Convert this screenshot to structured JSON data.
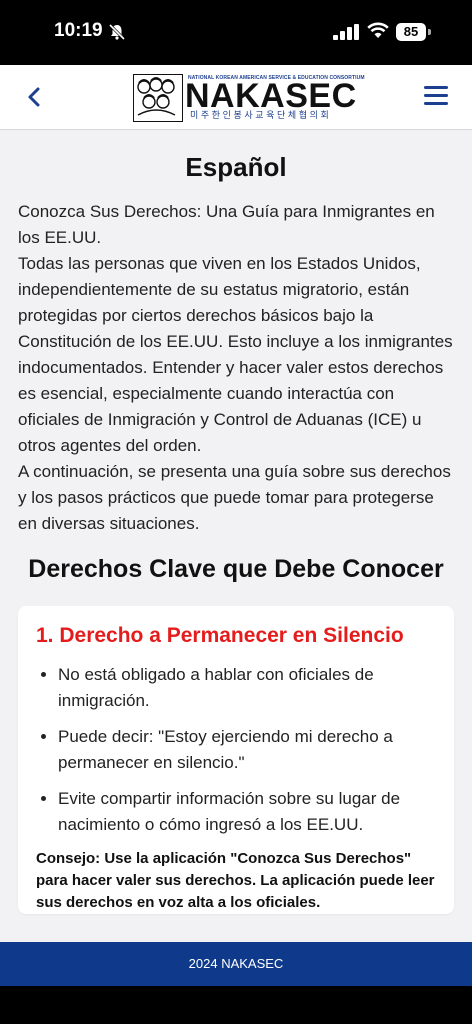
{
  "status_bar": {
    "time": "10:19",
    "battery": "85"
  },
  "header": {
    "logo_tagline": "NATIONAL KOREAN AMERICAN SERVICE & EDUCATION CONSORTIUM",
    "logo_name": "NAKASEC",
    "logo_korean": "미주한인봉사교육단체협의회"
  },
  "main": {
    "language_heading": "Español",
    "intro_paragraphs": [
      "Conozca Sus Derechos: Una Guía para Inmigrantes en los EE.UU.",
      "Todas las personas que viven en los Estados Unidos, independientemente de su estatus migratorio, están protegidas por ciertos derechos básicos bajo la Constitución de los EE.UU. Esto incluye a los inmigrantes indocumentados. Entender y hacer valer estos derechos es esencial, especialmente cuando interactúa con oficiales de Inmigración y Control de Aduanas (ICE) u otros agentes del orden.",
      "A continuación, se presenta una guía sobre sus derechos y los pasos prácticos que puede tomar para protegerse en diversas situaciones."
    ],
    "section_title": "Derechos Clave que Debe Conocer",
    "card": {
      "title": "1. Derecho a Permanecer en Silencio",
      "bullets": [
        "No está obligado a hablar con oficiales de inmigración.",
        "Puede decir: \"Estoy ejerciendo mi derecho a permanecer en silencio.\"",
        "Evite compartir información sobre su lugar de nacimiento o cómo ingresó a los EE.UU."
      ],
      "tip": "Consejo: Use la aplicación \"Conozca Sus Derechos\" para hacer valer sus derechos. La aplicación puede leer sus derechos en voz alta a los oficiales."
    }
  },
  "footer": {
    "text": "2024 NAKASEC"
  },
  "colors": {
    "brand_blue": "#1d3f8f",
    "footer_blue": "#0f3a8c",
    "accent_red": "#e41c1c"
  }
}
